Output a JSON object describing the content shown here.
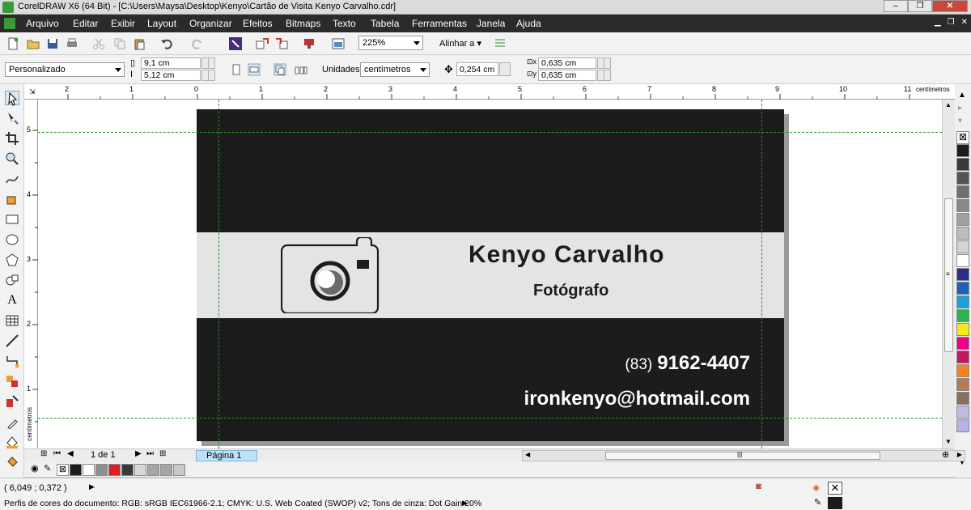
{
  "window": {
    "title": "CorelDRAW X6 (64 Bit) - [C:\\Users\\Maysa\\Desktop\\Kenyo\\Cartão de Visita Kenyo Carvalho.cdr]",
    "minimize": "–",
    "maximize": "❐",
    "close": "✕"
  },
  "menu": [
    "Arquivo",
    "Editar",
    "Exibir",
    "Layout",
    "Organizar",
    "Efeitos",
    "Bitmaps",
    "Texto",
    "Tabela",
    "Ferramentas",
    "Janela",
    "Ajuda"
  ],
  "toolbar": {
    "zoom": "225%",
    "align_label": "Alinhar a"
  },
  "properties": {
    "page_preset": "Personalizado",
    "width": "9,1 cm",
    "height": "5,12 cm",
    "units_label": "Unidades:",
    "units": "centímetros",
    "nudge": "0,254 cm",
    "dup_x": "0,635 cm",
    "dup_y": "0,635 cm"
  },
  "ruler": {
    "h_ticks": [
      "2",
      "1",
      "0",
      "1",
      "2",
      "3",
      "4",
      "5",
      "6",
      "7",
      "8",
      "9",
      "10",
      "11"
    ],
    "h_unit": "centímetros",
    "v_ticks": [
      "5",
      "4",
      "3",
      "2",
      "1"
    ],
    "v_unit": "centímetros"
  },
  "card": {
    "name": "Kenyo  Carvalho",
    "role": "Fotógrafo",
    "phone_area": "(83)",
    "phone_number": "9162-4407",
    "email": "ironkenyo@hotmail.com",
    "colors": {
      "background": "#1c1c1c",
      "band": "#e4e4e4",
      "text_light": "#ffffff"
    }
  },
  "pages": {
    "counter": "1 de 1",
    "tab": "Página 1"
  },
  "palette": [
    "#1c1c1c",
    "#3a3a3a",
    "#555555",
    "#6e6e6e",
    "#888888",
    "#a0a0a0",
    "#bcbcbc",
    "#d4d4d4",
    "#ffffff",
    "#2a2e8f",
    "#1f5fbf",
    "#1aa0dc",
    "#2bb44a",
    "#f5e81a",
    "#ec008c",
    "#c2185b",
    "#f58220",
    "#b97a57",
    "#8d6e63",
    "#c5b9e0",
    "#b3b3e6"
  ],
  "doc_palette": [
    "#1c1c1c",
    "#ffffff",
    "#8f8f8f",
    "#e02020",
    "#3a3a3a",
    "#d8d8d8",
    "#a6a6a6",
    "#a6a6a6",
    "#c8c8c8"
  ],
  "status": {
    "coords": "( 6,049 ; 0,372 )",
    "profiles": "Perfis de cores do documento: RGB: sRGB IEC61966-2.1; CMYK: U.S. Web Coated (SWOP) v2; Tons de cinza: Dot Gain 20%"
  }
}
